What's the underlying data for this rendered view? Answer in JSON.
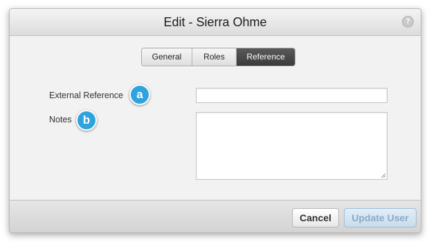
{
  "dialog": {
    "title": "Edit - Sierra Ohme",
    "help_icon": "?"
  },
  "tabs": [
    {
      "label": "General",
      "active": false
    },
    {
      "label": "Roles",
      "active": false
    },
    {
      "label": "Reference",
      "active": true
    }
  ],
  "form": {
    "external_reference": {
      "label": "External Reference",
      "badge": "a",
      "value": "",
      "placeholder": ""
    },
    "notes": {
      "label": "Notes",
      "badge": "b",
      "value": "",
      "placeholder": ""
    }
  },
  "footer": {
    "cancel_label": "Cancel",
    "update_label": "Update User",
    "update_enabled": false
  },
  "colors": {
    "badge": "#2fa3de",
    "active_tab": "#3b3b3b",
    "update_button_disabled_text": "#8aaac6"
  }
}
